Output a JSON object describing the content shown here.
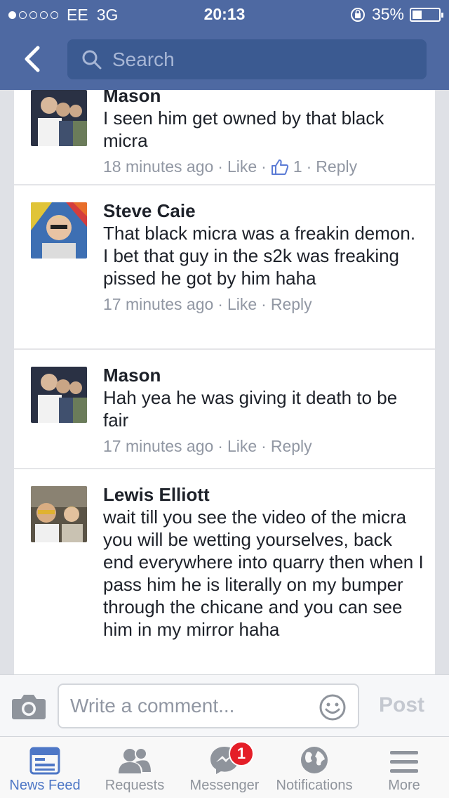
{
  "status_bar": {
    "carrier": "EE",
    "network": "3G",
    "time": "20:13",
    "battery": "35%",
    "battery_level": 0.35
  },
  "nav": {
    "search_placeholder": "Search"
  },
  "comments": [
    {
      "name": "Mason",
      "text": "I seen him get owned by that black micra",
      "time": "18 minutes ago",
      "like": "Like",
      "likes": "1",
      "reply": "Reply"
    },
    {
      "name": "Steve Caie",
      "text": "That black micra was a freakin demon. I bet that guy in the s2k was freaking pissed he got by him haha",
      "time": "17 minutes ago",
      "like": "Like",
      "reply": "Reply"
    },
    {
      "name": "Mason",
      "text": "Hah yea he was giving it death to be fair",
      "time": "17 minutes ago",
      "like": "Like",
      "reply": "Reply"
    },
    {
      "name": "Lewis Elliott",
      "text": "wait till you see the video of the micra you will be wetting yourselves, back end everywhere into quarry then when I pass him he is literally on my bumper through the chicane and you can see him in my mirror haha"
    }
  ],
  "composer": {
    "placeholder": "Write a comment...",
    "post_label": "Post"
  },
  "tabs": [
    {
      "label": "News Feed",
      "icon": "news-feed-icon",
      "active": true
    },
    {
      "label": "Requests",
      "icon": "requests-icon"
    },
    {
      "label": "Messenger",
      "icon": "messenger-icon",
      "badge": "1"
    },
    {
      "label": "Notifications",
      "icon": "globe-icon"
    },
    {
      "label": "More",
      "icon": "menu-icon"
    }
  ],
  "colors": {
    "brand": "#4e69a2",
    "active_tab": "#4e77c6",
    "badge": "#e41e28"
  }
}
